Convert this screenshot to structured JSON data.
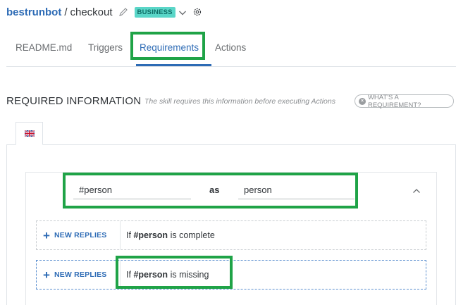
{
  "header": {
    "bot_name": "bestrunbot",
    "separator": "/",
    "skill_name": "checkout",
    "badge": "BUSINESS"
  },
  "tabs": [
    {
      "label": "README.md",
      "active": false
    },
    {
      "label": "Triggers",
      "active": false
    },
    {
      "label": "Requirements",
      "active": true
    },
    {
      "label": "Actions",
      "active": false
    }
  ],
  "section": {
    "title": "REQUIRED INFORMATION",
    "description": "The skill requires this information before executing Actions",
    "help_button": "WHAT'S A REQUIREMENT?"
  },
  "language_tab": {
    "icon": "uk-flag-icon"
  },
  "requirement": {
    "entity": "#person",
    "as_label": "as",
    "alias": "person"
  },
  "replies": [
    {
      "button": "NEW REPLIES",
      "prefix": "If",
      "entity": "#person",
      "suffix": "is complete"
    },
    {
      "button": "NEW REPLIES",
      "prefix": "If",
      "entity": "#person",
      "suffix": "is missing"
    }
  ],
  "colors": {
    "accent": "#2d6bb5",
    "badge_bg": "#5ad6c8",
    "highlight": "#1fa347"
  }
}
